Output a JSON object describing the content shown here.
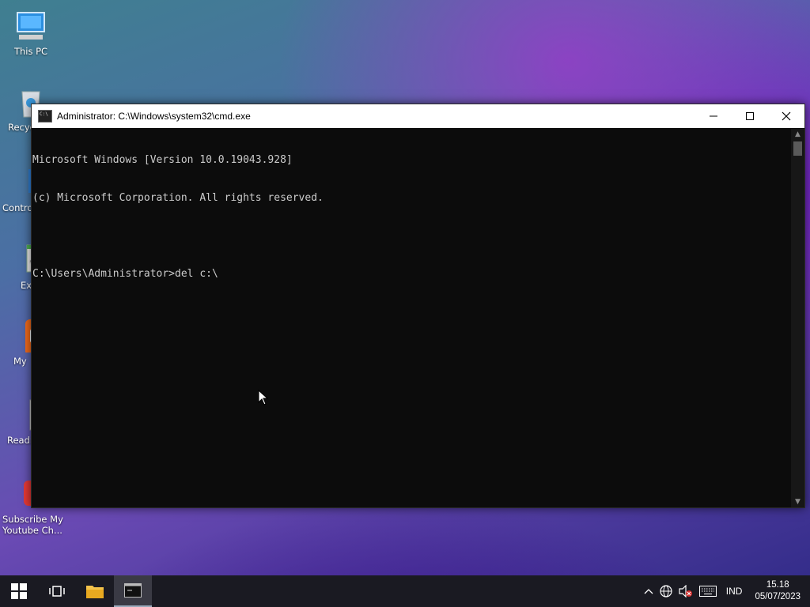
{
  "desktop": {
    "icons": [
      {
        "label": "This PC"
      },
      {
        "label": "Recyc"
      },
      {
        "label": "Contro"
      },
      {
        "label": "Ex"
      },
      {
        "label": "My"
      },
      {
        "label": "Readn"
      },
      {
        "label": "Subscribe My Youtube Ch..."
      }
    ]
  },
  "window": {
    "title": "Administrator: C:\\Windows\\system32\\cmd.exe",
    "console_lines": [
      "Microsoft Windows [Version 10.0.19043.928]",
      "(c) Microsoft Corporation. All rights reserved.",
      "",
      "C:\\Users\\Administrator>del c:\\"
    ]
  },
  "taskbar": {
    "language": "IND",
    "time": "15.18",
    "date": "05/07/2023"
  },
  "colors": {
    "console_bg": "#0c0c0c",
    "console_text": "#cccccc",
    "taskbar_bg": "#1a1a22"
  }
}
